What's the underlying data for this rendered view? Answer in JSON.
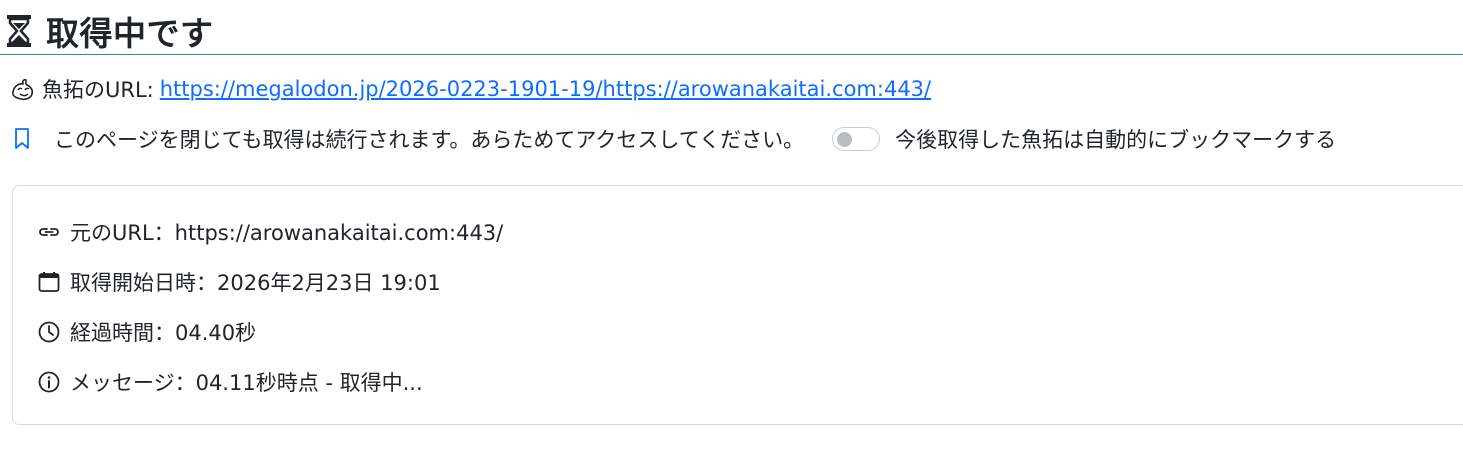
{
  "header": {
    "title": "取得中です",
    "icon": "hourglass-icon"
  },
  "archive": {
    "label": "魚拓のURL:",
    "url": "https://megalodon.jp/2026-0223-1901-19/https://arowanakaitai.com:443/",
    "icon": "fish-icon"
  },
  "notice": {
    "text": "このページを閉じても取得は続行されます。あらためてアクセスしてください。",
    "icon": "bookmark-icon",
    "toggle_label": "今後取得した魚拓は自動的にブックマークする",
    "toggle_on": false
  },
  "info": {
    "original_url": "元のURL：https://arowanakaitai.com:443/",
    "start_time": "取得開始日時：2026年2月23日 19:01",
    "elapsed": "経過時間：04.40秒",
    "message": "メッセージ：04.11秒時点 - 取得中..."
  },
  "colors": {
    "link": "#0d6efd",
    "rule": "#2b8bb0",
    "text": "#212529"
  }
}
